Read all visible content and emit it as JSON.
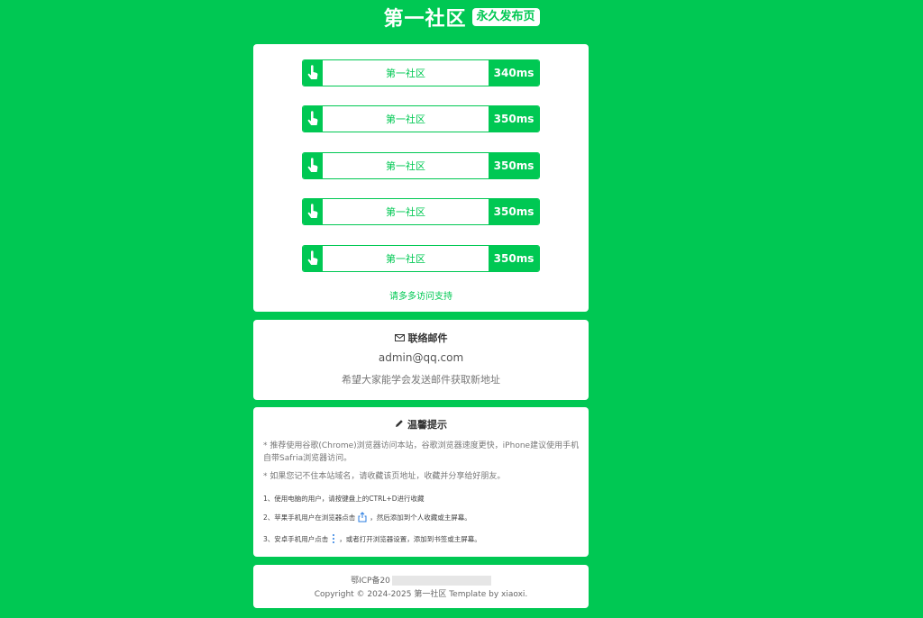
{
  "header": {
    "title": "第一社区",
    "badge": "永久发布页"
  },
  "links": {
    "items": [
      {
        "name": "第一社区",
        "speed": "340ms"
      },
      {
        "name": "第一社区",
        "speed": "350ms"
      },
      {
        "name": "第一社区",
        "speed": "350ms"
      },
      {
        "name": "第一社区",
        "speed": "350ms"
      },
      {
        "name": "第一社区",
        "speed": "350ms"
      }
    ],
    "support": "请多多访问支持"
  },
  "mail": {
    "title": "联络邮件",
    "address": "admin@qq.com",
    "note": "希望大家能学会发送邮件获取新地址"
  },
  "tips": {
    "title": "温馨提示",
    "para1": "* 推荐使用谷歌(Chrome)浏览器访问本站，谷歌浏览器速度更快，iPhone建议使用手机自带Safria浏览器访问。",
    "para2": "* 如果您记不住本站域名，请收藏该页地址，收藏并分享给好朋友。",
    "step1": "1、使用电脑的用户，请按键盘上的CTRL+D进行收藏",
    "step2_a": "2、苹果手机用户在浏览器点击",
    "step2_b": "，然后添加到个人收藏或主屏幕。",
    "step3_a": "3、安卓手机用户点击",
    "step3_b": "，或者打开浏览器设置，添加到书签或主屏幕。"
  },
  "footer": {
    "icp": "鄂ICP备20",
    "copyright": "Copyright © 2024-2025 第一社区 Template by xiaoxi."
  },
  "colors": {
    "accent": "#00c853"
  },
  "icons": {
    "link": "hand-pointer-icon",
    "mail": "envelope-icon",
    "tips": "pencil-icon",
    "share": "share-icon",
    "more": "more-vertical-icon"
  }
}
